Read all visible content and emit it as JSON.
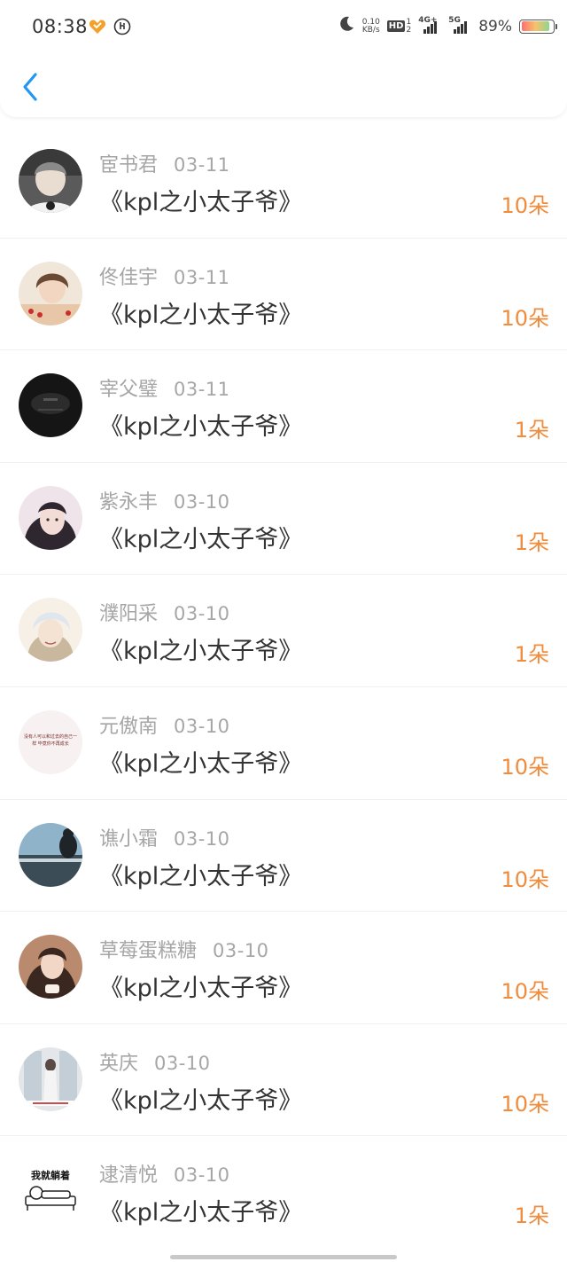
{
  "status_bar": {
    "time": "08:38",
    "net_speed_value": "0.10",
    "net_speed_unit": "KB/s",
    "hd_label": "HD",
    "sig1_label": "4G+",
    "sig2_label": "5G",
    "battery_percent": "89%",
    "battery_level": 0.89
  },
  "entries": [
    {
      "name": "宦书君",
      "date": "03-11",
      "title": "《kpl之小太子爷》",
      "amount": "10朵"
    },
    {
      "name": "佟佳宇",
      "date": "03-11",
      "title": "《kpl之小太子爷》",
      "amount": "10朵"
    },
    {
      "name": "宰父璧",
      "date": "03-11",
      "title": "《kpl之小太子爷》",
      "amount": "1朵"
    },
    {
      "name": "紫永丰",
      "date": "03-10",
      "title": "《kpl之小太子爷》",
      "amount": "1朵"
    },
    {
      "name": "濮阳采",
      "date": "03-10",
      "title": "《kpl之小太子爷》",
      "amount": "1朵"
    },
    {
      "name": "元傲南",
      "date": "03-10",
      "title": "《kpl之小太子爷》",
      "amount": "10朵"
    },
    {
      "name": "谯小霜",
      "date": "03-10",
      "title": "《kpl之小太子爷》",
      "amount": "10朵"
    },
    {
      "name": "草莓蛋糕糖",
      "date": "03-10",
      "title": "《kpl之小太子爷》",
      "amount": "10朵"
    },
    {
      "name": "英庆",
      "date": "03-10",
      "title": "《kpl之小太子爷》",
      "amount": "10朵"
    },
    {
      "name": "逮清悦",
      "date": "03-10",
      "title": "《kpl之小太子爷》",
      "amount": "1朵"
    }
  ],
  "avatar_text": {
    "avatar_6_caption": "没有人可以和过去的自己一样 毕竟你不再成长",
    "avatar_10_caption": "我就躺着"
  },
  "colors": {
    "accent_blue": "#2196f3",
    "amount_orange": "#f08c3c",
    "meta_gray": "#a6a6a6",
    "title_dark": "#333333"
  },
  "icons": {
    "back": "chevron-left-icon",
    "moon": "moon-icon",
    "heart": "heart-icon"
  }
}
